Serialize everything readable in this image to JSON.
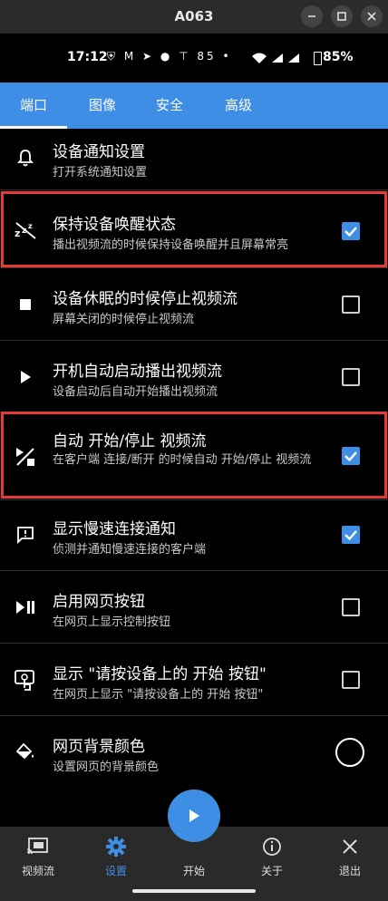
{
  "window": {
    "title": "A063",
    "minimize_icon": "minus-icon",
    "maximize_icon": "square-icon",
    "close_icon": "close-icon"
  },
  "status": {
    "time": "17:12",
    "icons_text": "⛨ M ➤ ● ⊤ 85 •",
    "battery": "85%"
  },
  "tabs": [
    {
      "label": "端口",
      "active": true
    },
    {
      "label": "图像",
      "active": false
    },
    {
      "label": "安全",
      "active": false
    },
    {
      "label": "高级",
      "active": false
    }
  ],
  "settings": [
    {
      "title": "设备通知设置",
      "subtitle": "打开系统通知设置",
      "icon": "bell-icon",
      "control": "none"
    },
    {
      "title": "保持设备唤醒状态",
      "subtitle": "播出视频流的时候保持设备唤醒并且屏幕常亮",
      "icon": "sleep-off-icon",
      "control": "checked"
    },
    {
      "title": "设备休眠的时候停止视频流",
      "subtitle": "屏幕关闭的时候停止视频流",
      "icon": "stop-icon",
      "control": "unchecked"
    },
    {
      "title": "开机自动启动播出视频流",
      "subtitle": "设备启动后自动开始播出视频流",
      "icon": "play-icon",
      "control": "unchecked"
    },
    {
      "title": "自动 开始/停止 视频流",
      "subtitle": "在客户端 连接/断开 的时候自动 开始/停止 视频流",
      "icon": "play-stop-toggle-icon",
      "control": "checked"
    },
    {
      "title": "显示慢速连接通知",
      "subtitle": "侦测并通知慢速连接的客户端",
      "icon": "alert-message-icon",
      "control": "checked"
    },
    {
      "title": "启用网页按钮",
      "subtitle": "在网页上显示控制按钮",
      "icon": "play-pause-icon",
      "control": "unchecked"
    },
    {
      "title": "显示 \"请按设备上的 开始 按钮\"",
      "subtitle": "在网页上显示 \"请按设备上的 开始 按钮\"",
      "icon": "touch-screen-icon",
      "control": "unchecked"
    },
    {
      "title": "网页背景颜色",
      "subtitle": "设置网页的背景颜色",
      "icon": "paint-bucket-icon",
      "control": "color"
    }
  ],
  "bottom_nav": [
    {
      "label": "视频流",
      "icon": "cast-icon",
      "active": false
    },
    {
      "label": "设置",
      "icon": "gear-icon",
      "active": true
    },
    {
      "label": "开始",
      "icon": "play-icon",
      "active": false
    },
    {
      "label": "关于",
      "icon": "info-icon",
      "active": false
    },
    {
      "label": "退出",
      "icon": "close-icon",
      "active": false
    }
  ],
  "colors": {
    "accent": "#3d8ee4",
    "highlight": "#e53935",
    "background": "#000000",
    "nav_background": "#2a2a2a"
  }
}
